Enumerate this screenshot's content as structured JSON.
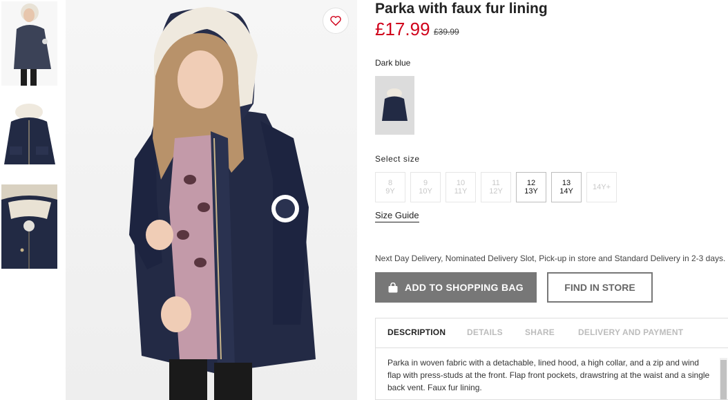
{
  "product": {
    "title": "Parka with faux fur lining",
    "price_current": "£17.99",
    "price_old": "£39.99",
    "color_name": "Dark blue",
    "size_label": "Select size",
    "sizes": [
      {
        "top": "8",
        "bottom": "9Y",
        "available": false
      },
      {
        "top": "9",
        "bottom": "10Y",
        "available": false
      },
      {
        "top": "10",
        "bottom": "11Y",
        "available": false
      },
      {
        "top": "11",
        "bottom": "12Y",
        "available": false
      },
      {
        "top": "12",
        "bottom": "13Y",
        "available": true
      },
      {
        "top": "13",
        "bottom": "14Y",
        "available": true
      },
      {
        "top": "14Y+",
        "bottom": "",
        "available": false
      }
    ],
    "size_guide_label": "Size Guide",
    "delivery_text": "Next Day Delivery, Nominated Delivery Slot, Pick-up in store and Standard Delivery in 2-3 days.",
    "add_to_bag_label": "ADD TO SHOPPING BAG",
    "find_in_store_label": "FIND IN STORE"
  },
  "tabs": [
    {
      "label": "DESCRIPTION",
      "active": true
    },
    {
      "label": "DETAILS",
      "active": false
    },
    {
      "label": "SHARE",
      "active": false
    },
    {
      "label": "DELIVERY AND PAYMENT",
      "active": false
    }
  ],
  "description": "Parka in woven fabric with a detachable, lined hood, a high collar, and a zip and wind flap with press-studs at the front. Flap front pockets, drawstring at the waist and a single back vent. Faux fur lining.",
  "icons": {
    "wishlist": "heart-icon",
    "bag": "shopping-bag-icon"
  },
  "colors": {
    "price_red": "#d0021b",
    "button_grey": "#777777",
    "jacket_navy": "#222a44",
    "fur_cream": "#efe9de"
  }
}
